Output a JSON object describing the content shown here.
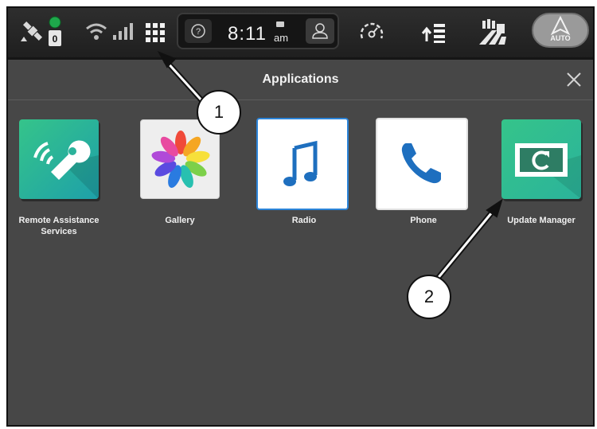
{
  "status": {
    "satellite_badge": "0",
    "time": "8:11",
    "ampm": "am",
    "auto_label": "AUTO"
  },
  "header": {
    "title": "Applications"
  },
  "apps": [
    {
      "label": "Remote Assistance Services",
      "icon": "wrench-signal-icon"
    },
    {
      "label": "Gallery",
      "icon": "flower-icon"
    },
    {
      "label": "Radio",
      "icon": "music-note-icon"
    },
    {
      "label": "Phone",
      "icon": "phone-icon"
    },
    {
      "label": "Update Manager",
      "icon": "refresh-screen-icon"
    }
  ],
  "callouts": [
    "1",
    "2"
  ]
}
